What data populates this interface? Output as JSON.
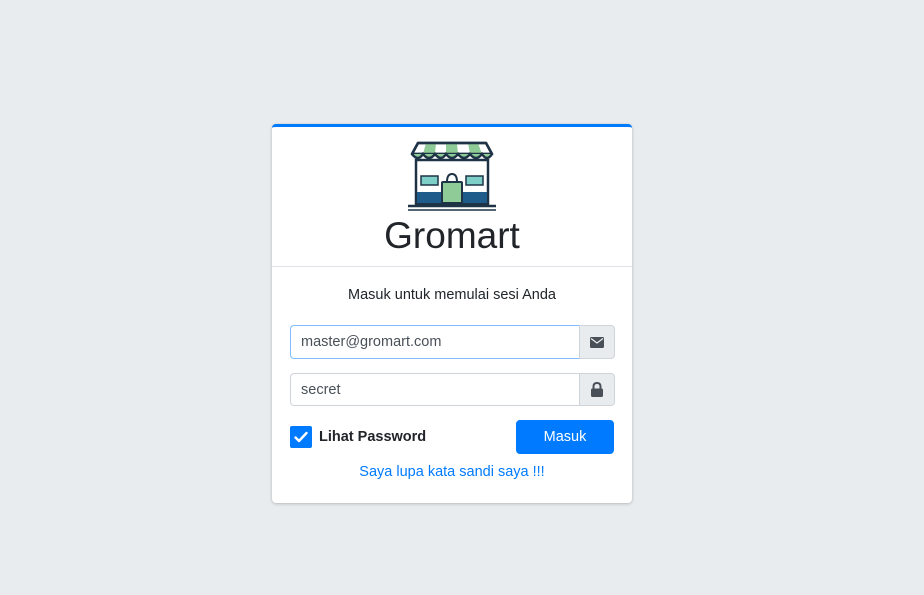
{
  "brand": {
    "name": "Gromart",
    "logo_icon": "store-icon"
  },
  "login": {
    "message": "Masuk untuk memulai sesi Anda",
    "email_value": "master@gromart.com",
    "email_icon": "envelope-icon",
    "password_value": "secret",
    "password_icon": "lock-icon",
    "show_password_label": "Lihat Password",
    "show_password_checked": true,
    "submit_label": "Masuk",
    "forgot_link": "Saya lupa kata sandi saya !!!"
  },
  "colors": {
    "accent": "#007bff",
    "background": "#e9ecef"
  }
}
